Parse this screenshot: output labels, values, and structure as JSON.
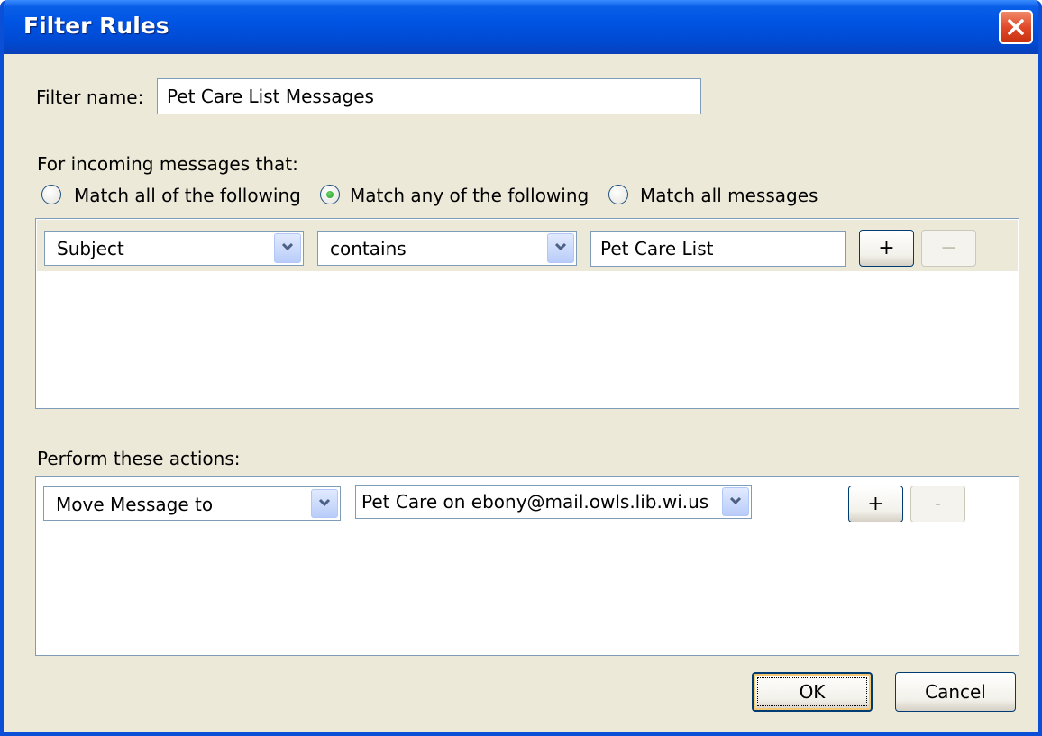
{
  "window": {
    "title": "Filter Rules"
  },
  "filter_name": {
    "label": "Filter name:",
    "value": "Pet Care List Messages"
  },
  "conditions": {
    "heading": "For incoming messages that:",
    "radios": [
      {
        "label": "Match all of the following",
        "selected": false
      },
      {
        "label": "Match any of the following",
        "selected": true
      },
      {
        "label": "Match all messages",
        "selected": false
      }
    ],
    "row": {
      "field": "Subject",
      "operator": "contains",
      "value": "Pet Care List",
      "add_label": "+",
      "remove_label": "−"
    }
  },
  "actions": {
    "heading": "Perform these actions:",
    "row": {
      "action": "Move Message to",
      "target": "Pet Care on ebony@mail.owls.lib.wi.us",
      "add_label": "+",
      "remove_label": "-"
    }
  },
  "footer": {
    "ok_label": "OK",
    "cancel_label": "Cancel"
  }
}
